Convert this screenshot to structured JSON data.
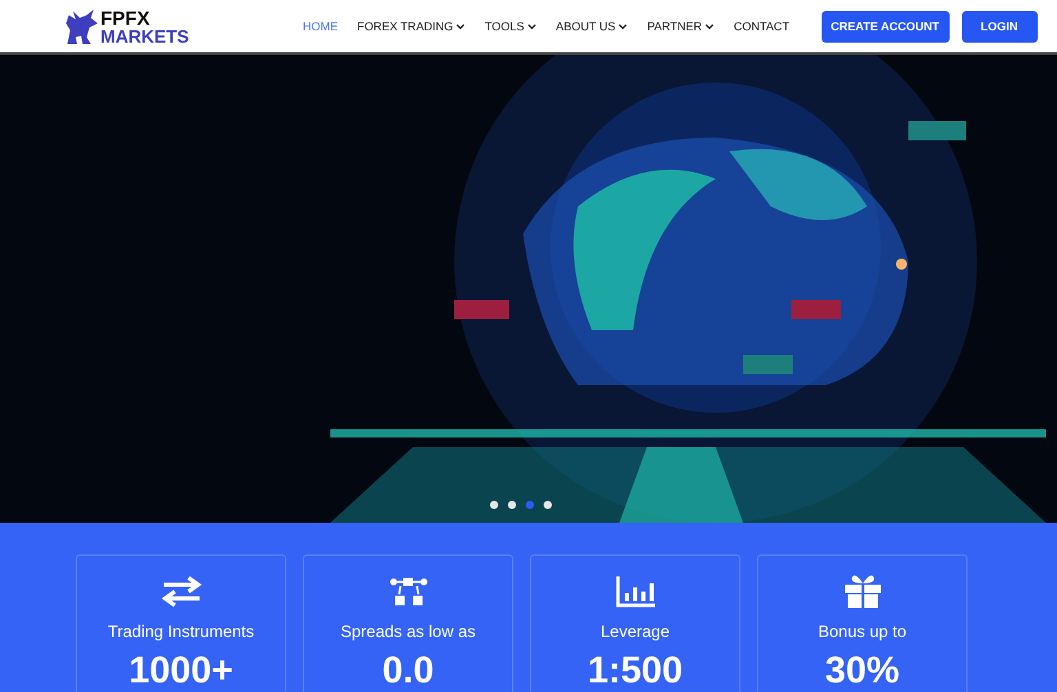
{
  "logo": {
    "top": "FPFX",
    "bottom": "MARKETS"
  },
  "nav": [
    {
      "label": "HOME",
      "selected": true,
      "dropdown": false
    },
    {
      "label": "FOREX TRADING",
      "selected": false,
      "dropdown": true
    },
    {
      "label": "TOOLS",
      "selected": false,
      "dropdown": true
    },
    {
      "label": "ABOUT US",
      "selected": false,
      "dropdown": true
    },
    {
      "label": "PARTNER",
      "selected": false,
      "dropdown": true
    },
    {
      "label": "CONTACT",
      "selected": false,
      "dropdown": false
    }
  ],
  "buttons": [
    "CREATE ACCOUNT",
    "LOGIN"
  ],
  "hero": {
    "kind": "picture",
    "slides": [
      {
        "selected": false
      },
      {
        "selected": false
      },
      {
        "selected": true
      },
      {
        "selected": false
      }
    ]
  },
  "stats": [
    {
      "label": "Trading Instruments",
      "value": "1000+"
    },
    {
      "label": "Spreads as low as",
      "value": "0.0"
    },
    {
      "label": "Leverage",
      "value": "1:500"
    },
    {
      "label": "Bonus up to",
      "value": "30%"
    }
  ]
}
